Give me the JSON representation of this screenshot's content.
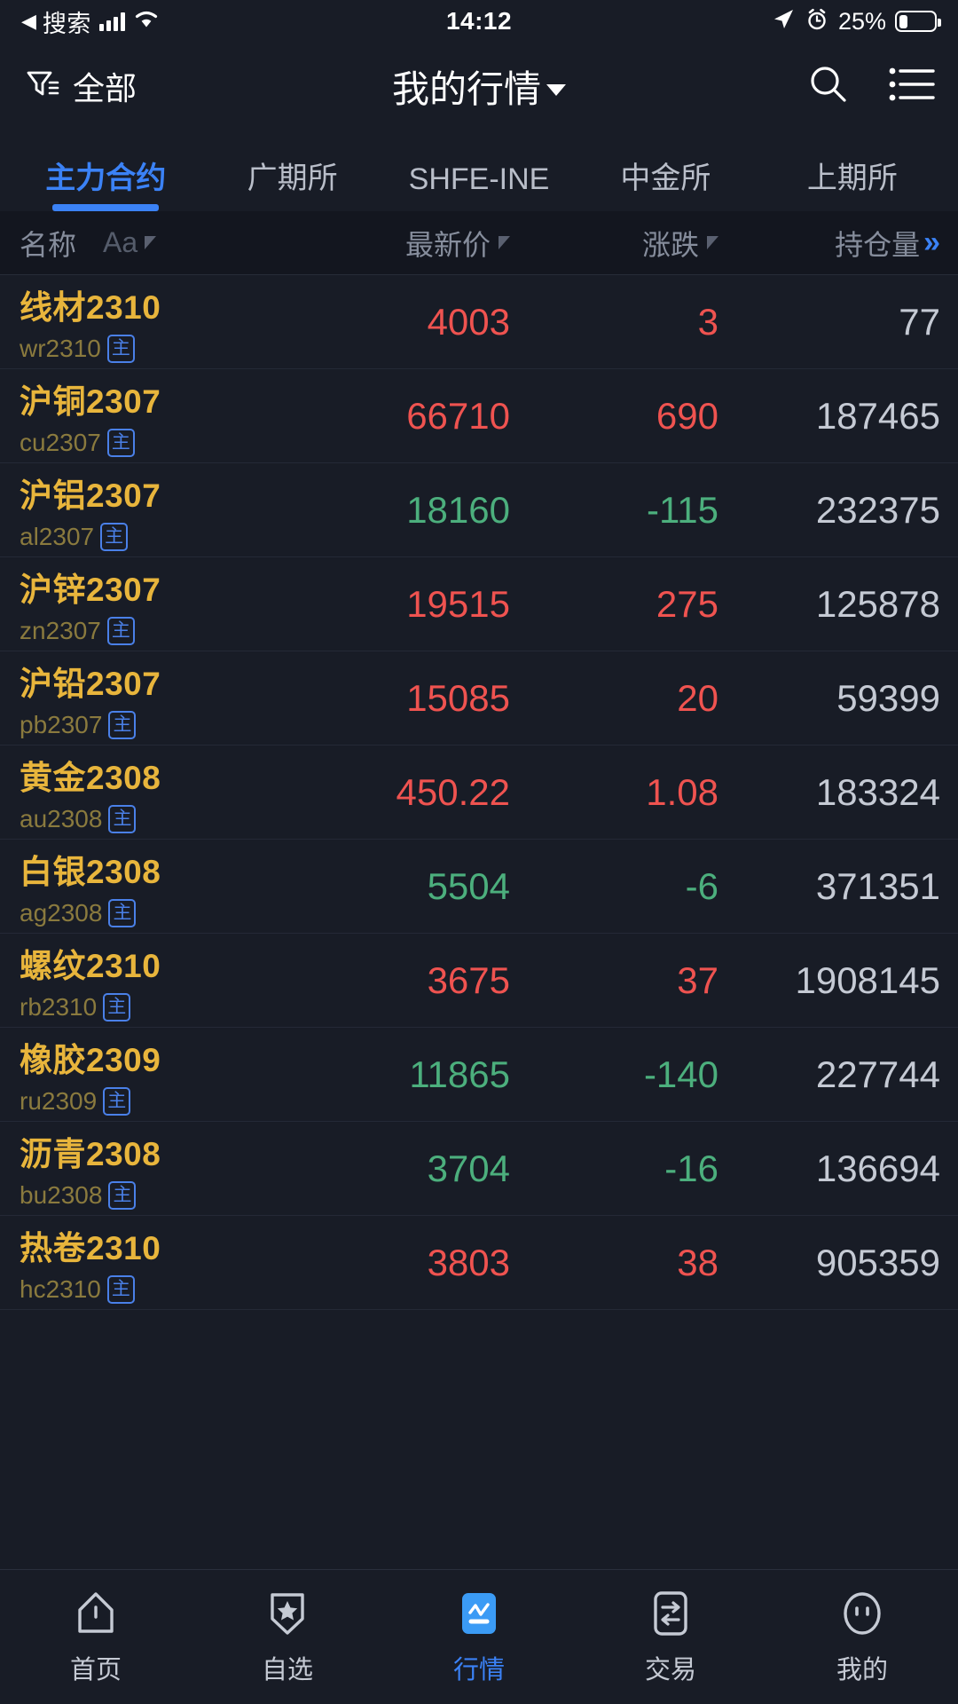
{
  "status_bar": {
    "back_glyph": "◀",
    "carrier": "搜索",
    "signal_icon": "signal-bars-icon",
    "wifi_icon": "wifi-icon",
    "time": "14:12",
    "location_icon": "location-arrow-icon",
    "alarm_icon": "alarm-clock-icon",
    "battery_percent": "25%",
    "battery_level": 25
  },
  "header": {
    "filter_icon": "filter-funnel-icon",
    "filter_label": "全部",
    "title": "我的行情",
    "dropdown_icon": "chevron-down-icon",
    "search_icon": "search-icon",
    "menu_icon": "list-menu-icon"
  },
  "tabs": [
    {
      "label": "主力合约",
      "active": true
    },
    {
      "label": "广期所",
      "active": false
    },
    {
      "label": "SHFE-INE",
      "active": false
    },
    {
      "label": "中金所",
      "active": false
    },
    {
      "label": "上期所",
      "active": false
    }
  ],
  "columns": {
    "name": "名称",
    "aa": "Aa",
    "price": "最新价",
    "change": "涨跌",
    "open_interest": "持仓量",
    "expand_icon": "double-chevron-right-icon"
  },
  "colors": {
    "up": "#ef5350",
    "down": "#4caf7d",
    "accent": "#3b82f6",
    "name": "#e8b53c",
    "code": "#8a7a3e",
    "background": "#181c26"
  },
  "rows": [
    {
      "name": "线材2310",
      "code": "wr2310",
      "badge": "主",
      "price": "4003",
      "change": "3",
      "oi": "77",
      "dir": "up"
    },
    {
      "name": "沪铜2307",
      "code": "cu2307",
      "badge": "主",
      "price": "66710",
      "change": "690",
      "oi": "187465",
      "dir": "up"
    },
    {
      "name": "沪铝2307",
      "code": "al2307",
      "badge": "主",
      "price": "18160",
      "change": "-115",
      "oi": "232375",
      "dir": "down"
    },
    {
      "name": "沪锌2307",
      "code": "zn2307",
      "badge": "主",
      "price": "19515",
      "change": "275",
      "oi": "125878",
      "dir": "up"
    },
    {
      "name": "沪铅2307",
      "code": "pb2307",
      "badge": "主",
      "price": "15085",
      "change": "20",
      "oi": "59399",
      "dir": "up"
    },
    {
      "name": "黄金2308",
      "code": "au2308",
      "badge": "主",
      "price": "450.22",
      "change": "1.08",
      "oi": "183324",
      "dir": "up"
    },
    {
      "name": "白银2308",
      "code": "ag2308",
      "badge": "主",
      "price": "5504",
      "change": "-6",
      "oi": "371351",
      "dir": "down"
    },
    {
      "name": "螺纹2310",
      "code": "rb2310",
      "badge": "主",
      "price": "3675",
      "change": "37",
      "oi": "1908145",
      "dir": "up"
    },
    {
      "name": "橡胶2309",
      "code": "ru2309",
      "badge": "主",
      "price": "11865",
      "change": "-140",
      "oi": "227744",
      "dir": "down"
    },
    {
      "name": "沥青2308",
      "code": "bu2308",
      "badge": "主",
      "price": "3704",
      "change": "-16",
      "oi": "136694",
      "dir": "down"
    },
    {
      "name": "热卷2310",
      "code": "hc2310",
      "badge": "主",
      "price": "3803",
      "change": "38",
      "oi": "905359",
      "dir": "up"
    }
  ],
  "bottom_nav": [
    {
      "label": "首页",
      "icon": "home-icon",
      "active": false
    },
    {
      "label": "自选",
      "icon": "star-badge-icon",
      "active": false
    },
    {
      "label": "行情",
      "icon": "market-chart-icon",
      "active": true
    },
    {
      "label": "交易",
      "icon": "exchange-arrows-icon",
      "active": false
    },
    {
      "label": "我的",
      "icon": "profile-face-icon",
      "active": false
    }
  ]
}
